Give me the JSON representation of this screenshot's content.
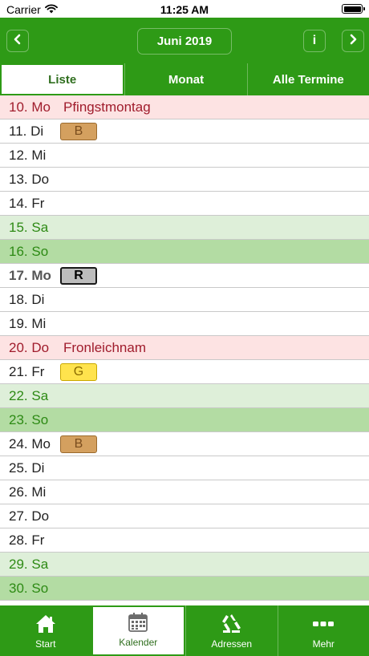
{
  "status_bar": {
    "carrier": "Carrier",
    "time": "11:25 AM"
  },
  "header": {
    "prev_icon": "chevron-left-icon",
    "month": "Juni 2019",
    "info_label": "i",
    "next_icon": "chevron-right-icon"
  },
  "tabs": [
    {
      "label": "Liste",
      "active": true
    },
    {
      "label": "Monat",
      "active": false
    },
    {
      "label": "Alle Termine",
      "active": false
    }
  ],
  "rows": [
    {
      "date": "10. Mo",
      "name": "Pfingstmontag",
      "type": "holiday"
    },
    {
      "date": "11. Di",
      "badge": "B",
      "badge_color": "brown"
    },
    {
      "date": "12. Mi"
    },
    {
      "date": "13. Do"
    },
    {
      "date": "14. Fr"
    },
    {
      "date": "15. Sa",
      "type": "sat"
    },
    {
      "date": "16. So",
      "type": "sun"
    },
    {
      "date": "17. Mo",
      "badge": "R",
      "badge_color": "grey",
      "type": "bold"
    },
    {
      "date": "18. Di"
    },
    {
      "date": "19. Mi"
    },
    {
      "date": "20. Do",
      "name": "Fronleichnam",
      "type": "holiday"
    },
    {
      "date": "21. Fr",
      "badge": "G",
      "badge_color": "yellow"
    },
    {
      "date": "22. Sa",
      "type": "sat"
    },
    {
      "date": "23. So",
      "type": "sun"
    },
    {
      "date": "24. Mo",
      "badge": "B",
      "badge_color": "brown"
    },
    {
      "date": "25. Di"
    },
    {
      "date": "26. Mi"
    },
    {
      "date": "27. Do"
    },
    {
      "date": "28. Fr"
    },
    {
      "date": "29. Sa",
      "type": "sat"
    },
    {
      "date": "30. So",
      "type": "sun"
    }
  ],
  "bottom_nav": [
    {
      "label": "Start",
      "icon": "home-icon",
      "active": false
    },
    {
      "label": "Kalender",
      "icon": "calendar-icon",
      "active": true
    },
    {
      "label": "Adressen",
      "icon": "recycle-icon",
      "active": false
    },
    {
      "label": "Mehr",
      "icon": "more-icon",
      "active": false
    }
  ],
  "colors": {
    "brand_green": "#2e9a16",
    "holiday_bg": "#fde3e3",
    "holiday_text": "#a01c2c",
    "saturday_bg": "#deefd9",
    "sunday_bg": "#b3dca3",
    "weekend_text": "#2d8a14"
  }
}
